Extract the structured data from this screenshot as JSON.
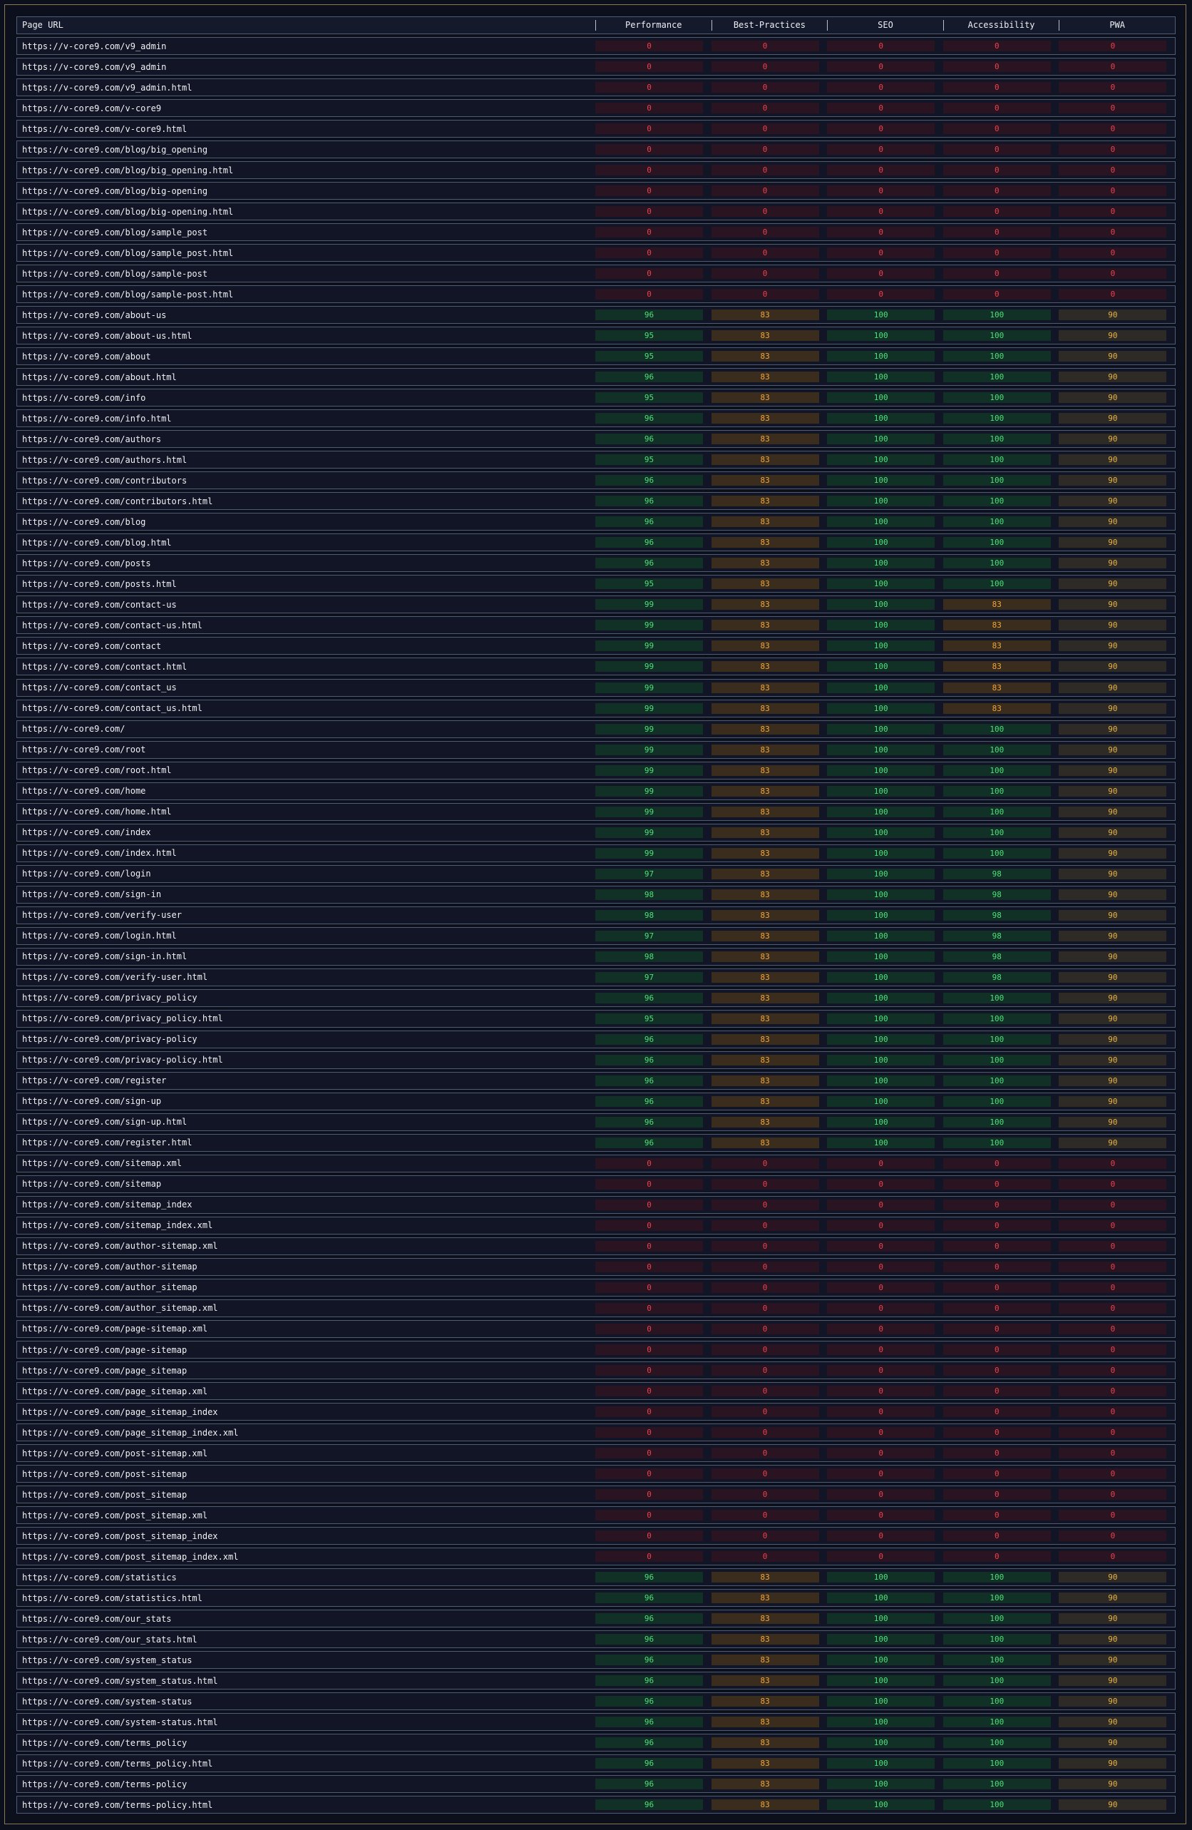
{
  "table": {
    "headers": [
      "Page URL",
      "Performance",
      "Best-Practices",
      "SEO",
      "Accessibility",
      "PWA"
    ],
    "rows": [
      {
        "url": "https://v-core9.com/v9_admin",
        "scores": [
          "0",
          "0",
          "0",
          "0",
          "0"
        ]
      },
      {
        "url": "https://v-core9.com/v9_admin",
        "scores": [
          "0",
          "0",
          "0",
          "0",
          "0"
        ]
      },
      {
        "url": "https://v-core9.com/v9_admin.html",
        "scores": [
          "0",
          "0",
          "0",
          "0",
          "0"
        ]
      },
      {
        "url": "https://v-core9.com/v-core9",
        "scores": [
          "0",
          "0",
          "0",
          "0",
          "0"
        ]
      },
      {
        "url": "https://v-core9.com/v-core9.html",
        "scores": [
          "0",
          "0",
          "0",
          "0",
          "0"
        ]
      },
      {
        "url": "https://v-core9.com/blog/big_opening",
        "scores": [
          "0",
          "0",
          "0",
          "0",
          "0"
        ]
      },
      {
        "url": "https://v-core9.com/blog/big_opening.html",
        "scores": [
          "0",
          "0",
          "0",
          "0",
          "0"
        ]
      },
      {
        "url": "https://v-core9.com/blog/big-opening",
        "scores": [
          "0",
          "0",
          "0",
          "0",
          "0"
        ]
      },
      {
        "url": "https://v-core9.com/blog/big-opening.html",
        "scores": [
          "0",
          "0",
          "0",
          "0",
          "0"
        ]
      },
      {
        "url": "https://v-core9.com/blog/sample_post",
        "scores": [
          "0",
          "0",
          "0",
          "0",
          "0"
        ]
      },
      {
        "url": "https://v-core9.com/blog/sample_post.html",
        "scores": [
          "0",
          "0",
          "0",
          "0",
          "0"
        ]
      },
      {
        "url": "https://v-core9.com/blog/sample-post",
        "scores": [
          "0",
          "0",
          "0",
          "0",
          "0"
        ]
      },
      {
        "url": "https://v-core9.com/blog/sample-post.html",
        "scores": [
          "0",
          "0",
          "0",
          "0",
          "0"
        ]
      },
      {
        "url": "https://v-core9.com/about-us",
        "scores": [
          "96",
          "83",
          "100",
          "100",
          "90"
        ]
      },
      {
        "url": "https://v-core9.com/about-us.html",
        "scores": [
          "95",
          "83",
          "100",
          "100",
          "90"
        ]
      },
      {
        "url": "https://v-core9.com/about",
        "scores": [
          "95",
          "83",
          "100",
          "100",
          "90"
        ]
      },
      {
        "url": "https://v-core9.com/about.html",
        "scores": [
          "96",
          "83",
          "100",
          "100",
          "90"
        ]
      },
      {
        "url": "https://v-core9.com/info",
        "scores": [
          "95",
          "83",
          "100",
          "100",
          "90"
        ]
      },
      {
        "url": "https://v-core9.com/info.html",
        "scores": [
          "96",
          "83",
          "100",
          "100",
          "90"
        ]
      },
      {
        "url": "https://v-core9.com/authors",
        "scores": [
          "96",
          "83",
          "100",
          "100",
          "90"
        ]
      },
      {
        "url": "https://v-core9.com/authors.html",
        "scores": [
          "95",
          "83",
          "100",
          "100",
          "90"
        ]
      },
      {
        "url": "https://v-core9.com/contributors",
        "scores": [
          "96",
          "83",
          "100",
          "100",
          "90"
        ]
      },
      {
        "url": "https://v-core9.com/contributors.html",
        "scores": [
          "96",
          "83",
          "100",
          "100",
          "90"
        ]
      },
      {
        "url": "https://v-core9.com/blog",
        "scores": [
          "96",
          "83",
          "100",
          "100",
          "90"
        ]
      },
      {
        "url": "https://v-core9.com/blog.html",
        "scores": [
          "96",
          "83",
          "100",
          "100",
          "90"
        ]
      },
      {
        "url": "https://v-core9.com/posts",
        "scores": [
          "96",
          "83",
          "100",
          "100",
          "90"
        ]
      },
      {
        "url": "https://v-core9.com/posts.html",
        "scores": [
          "95",
          "83",
          "100",
          "100",
          "90"
        ]
      },
      {
        "url": "https://v-core9.com/contact-us",
        "scores": [
          "99",
          "83",
          "100",
          "83",
          "90"
        ]
      },
      {
        "url": "https://v-core9.com/contact-us.html",
        "scores": [
          "99",
          "83",
          "100",
          "83",
          "90"
        ]
      },
      {
        "url": "https://v-core9.com/contact",
        "scores": [
          "99",
          "83",
          "100",
          "83",
          "90"
        ]
      },
      {
        "url": "https://v-core9.com/contact.html",
        "scores": [
          "99",
          "83",
          "100",
          "83",
          "90"
        ]
      },
      {
        "url": "https://v-core9.com/contact_us",
        "scores": [
          "99",
          "83",
          "100",
          "83",
          "90"
        ]
      },
      {
        "url": "https://v-core9.com/contact_us.html",
        "scores": [
          "99",
          "83",
          "100",
          "83",
          "90"
        ]
      },
      {
        "url": "https://v-core9.com/",
        "scores": [
          "99",
          "83",
          "100",
          "100",
          "90"
        ]
      },
      {
        "url": "https://v-core9.com/root",
        "scores": [
          "99",
          "83",
          "100",
          "100",
          "90"
        ]
      },
      {
        "url": "https://v-core9.com/root.html",
        "scores": [
          "99",
          "83",
          "100",
          "100",
          "90"
        ]
      },
      {
        "url": "https://v-core9.com/home",
        "scores": [
          "99",
          "83",
          "100",
          "100",
          "90"
        ]
      },
      {
        "url": "https://v-core9.com/home.html",
        "scores": [
          "99",
          "83",
          "100",
          "100",
          "90"
        ]
      },
      {
        "url": "https://v-core9.com/index",
        "scores": [
          "99",
          "83",
          "100",
          "100",
          "90"
        ]
      },
      {
        "url": "https://v-core9.com/index.html",
        "scores": [
          "99",
          "83",
          "100",
          "100",
          "90"
        ]
      },
      {
        "url": "https://v-core9.com/login",
        "scores": [
          "97",
          "83",
          "100",
          "98",
          "90"
        ]
      },
      {
        "url": "https://v-core9.com/sign-in",
        "scores": [
          "98",
          "83",
          "100",
          "98",
          "90"
        ]
      },
      {
        "url": "https://v-core9.com/verify-user",
        "scores": [
          "98",
          "83",
          "100",
          "98",
          "90"
        ]
      },
      {
        "url": "https://v-core9.com/login.html",
        "scores": [
          "97",
          "83",
          "100",
          "98",
          "90"
        ]
      },
      {
        "url": "https://v-core9.com/sign-in.html",
        "scores": [
          "98",
          "83",
          "100",
          "98",
          "90"
        ]
      },
      {
        "url": "https://v-core9.com/verify-user.html",
        "scores": [
          "97",
          "83",
          "100",
          "98",
          "90"
        ]
      },
      {
        "url": "https://v-core9.com/privacy_policy",
        "scores": [
          "96",
          "83",
          "100",
          "100",
          "90"
        ]
      },
      {
        "url": "https://v-core9.com/privacy_policy.html",
        "scores": [
          "95",
          "83",
          "100",
          "100",
          "90"
        ]
      },
      {
        "url": "https://v-core9.com/privacy-policy",
        "scores": [
          "96",
          "83",
          "100",
          "100",
          "90"
        ]
      },
      {
        "url": "https://v-core9.com/privacy-policy.html",
        "scores": [
          "96",
          "83",
          "100",
          "100",
          "90"
        ]
      },
      {
        "url": "https://v-core9.com/register",
        "scores": [
          "96",
          "83",
          "100",
          "100",
          "90"
        ]
      },
      {
        "url": "https://v-core9.com/sign-up",
        "scores": [
          "96",
          "83",
          "100",
          "100",
          "90"
        ]
      },
      {
        "url": "https://v-core9.com/sign-up.html",
        "scores": [
          "96",
          "83",
          "100",
          "100",
          "90"
        ]
      },
      {
        "url": "https://v-core9.com/register.html",
        "scores": [
          "96",
          "83",
          "100",
          "100",
          "90"
        ]
      },
      {
        "url": "https://v-core9.com/sitemap.xml",
        "scores": [
          "0",
          "0",
          "0",
          "0",
          "0"
        ]
      },
      {
        "url": "https://v-core9.com/sitemap",
        "scores": [
          "0",
          "0",
          "0",
          "0",
          "0"
        ]
      },
      {
        "url": "https://v-core9.com/sitemap_index",
        "scores": [
          "0",
          "0",
          "0",
          "0",
          "0"
        ]
      },
      {
        "url": "https://v-core9.com/sitemap_index.xml",
        "scores": [
          "0",
          "0",
          "0",
          "0",
          "0"
        ]
      },
      {
        "url": "https://v-core9.com/author-sitemap.xml",
        "scores": [
          "0",
          "0",
          "0",
          "0",
          "0"
        ]
      },
      {
        "url": "https://v-core9.com/author-sitemap",
        "scores": [
          "0",
          "0",
          "0",
          "0",
          "0"
        ]
      },
      {
        "url": "https://v-core9.com/author_sitemap",
        "scores": [
          "0",
          "0",
          "0",
          "0",
          "0"
        ]
      },
      {
        "url": "https://v-core9.com/author_sitemap.xml",
        "scores": [
          "0",
          "0",
          "0",
          "0",
          "0"
        ]
      },
      {
        "url": "https://v-core9.com/page-sitemap.xml",
        "scores": [
          "0",
          "0",
          "0",
          "0",
          "0"
        ]
      },
      {
        "url": "https://v-core9.com/page-sitemap",
        "scores": [
          "0",
          "0",
          "0",
          "0",
          "0"
        ]
      },
      {
        "url": "https://v-core9.com/page_sitemap",
        "scores": [
          "0",
          "0",
          "0",
          "0",
          "0"
        ]
      },
      {
        "url": "https://v-core9.com/page_sitemap.xml",
        "scores": [
          "0",
          "0",
          "0",
          "0",
          "0"
        ]
      },
      {
        "url": "https://v-core9.com/page_sitemap_index",
        "scores": [
          "0",
          "0",
          "0",
          "0",
          "0"
        ]
      },
      {
        "url": "https://v-core9.com/page_sitemap_index.xml",
        "scores": [
          "0",
          "0",
          "0",
          "0",
          "0"
        ]
      },
      {
        "url": "https://v-core9.com/post-sitemap.xml",
        "scores": [
          "0",
          "0",
          "0",
          "0",
          "0"
        ]
      },
      {
        "url": "https://v-core9.com/post-sitemap",
        "scores": [
          "0",
          "0",
          "0",
          "0",
          "0"
        ]
      },
      {
        "url": "https://v-core9.com/post_sitemap",
        "scores": [
          "0",
          "0",
          "0",
          "0",
          "0"
        ]
      },
      {
        "url": "https://v-core9.com/post_sitemap.xml",
        "scores": [
          "0",
          "0",
          "0",
          "0",
          "0"
        ]
      },
      {
        "url": "https://v-core9.com/post_sitemap_index",
        "scores": [
          "0",
          "0",
          "0",
          "0",
          "0"
        ]
      },
      {
        "url": "https://v-core9.com/post_sitemap_index.xml",
        "scores": [
          "0",
          "0",
          "0",
          "0",
          "0"
        ]
      },
      {
        "url": "https://v-core9.com/statistics",
        "scores": [
          "96",
          "83",
          "100",
          "100",
          "90"
        ]
      },
      {
        "url": "https://v-core9.com/statistics.html",
        "scores": [
          "96",
          "83",
          "100",
          "100",
          "90"
        ]
      },
      {
        "url": "https://v-core9.com/our_stats",
        "scores": [
          "96",
          "83",
          "100",
          "100",
          "90"
        ]
      },
      {
        "url": "https://v-core9.com/our_stats.html",
        "scores": [
          "96",
          "83",
          "100",
          "100",
          "90"
        ]
      },
      {
        "url": "https://v-core9.com/system_status",
        "scores": [
          "96",
          "83",
          "100",
          "100",
          "90"
        ]
      },
      {
        "url": "https://v-core9.com/system_status.html",
        "scores": [
          "96",
          "83",
          "100",
          "100",
          "90"
        ]
      },
      {
        "url": "https://v-core9.com/system-status",
        "scores": [
          "96",
          "83",
          "100",
          "100",
          "90"
        ]
      },
      {
        "url": "https://v-core9.com/system-status.html",
        "scores": [
          "96",
          "83",
          "100",
          "100",
          "90"
        ]
      },
      {
        "url": "https://v-core9.com/terms_policy",
        "scores": [
          "96",
          "83",
          "100",
          "100",
          "90"
        ]
      },
      {
        "url": "https://v-core9.com/terms_policy.html",
        "scores": [
          "96",
          "83",
          "100",
          "100",
          "90"
        ]
      },
      {
        "url": "https://v-core9.com/terms-policy",
        "scores": [
          "96",
          "83",
          "100",
          "100",
          "90"
        ]
      },
      {
        "url": "https://v-core9.com/terms-policy.html",
        "scores": [
          "96",
          "83",
          "100",
          "100",
          "90"
        ]
      }
    ]
  },
  "colors": {
    "zero": "#e8434f",
    "good": "#4fe07a",
    "medium": "#f0a53a",
    "pwa": "#e8b445"
  }
}
